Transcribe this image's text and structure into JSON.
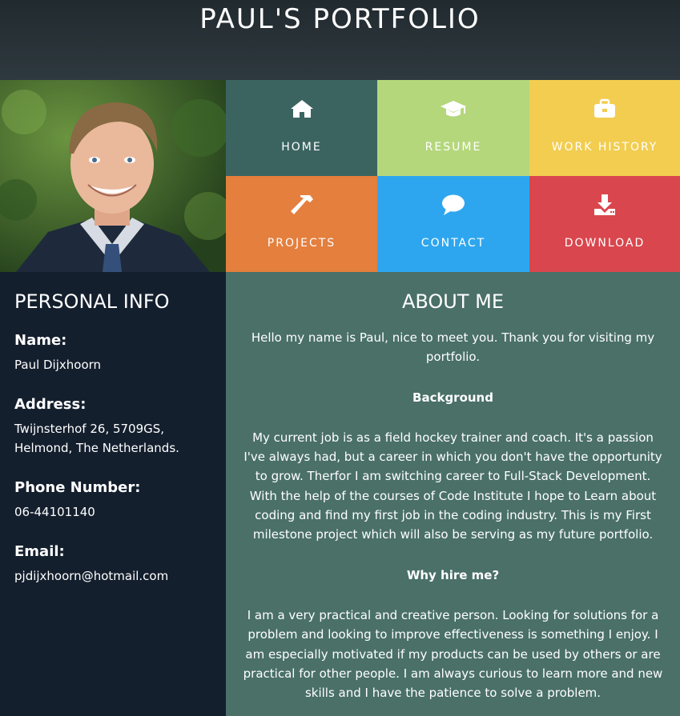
{
  "header": {
    "title": "PAUL'S PORTFOLIO"
  },
  "colors": {
    "home": "#3b6461",
    "resume": "#b5d77c",
    "work": "#f2cd50",
    "projects": "#e47f3e",
    "contact": "#2da6ef",
    "download": "#d9464d",
    "sidebar": "#141f2e",
    "main": "#4a7068"
  },
  "nav": {
    "home": {
      "label": "HOME",
      "icon": "home-icon"
    },
    "resume": {
      "label": "RESUME",
      "icon": "graduation-cap-icon"
    },
    "work": {
      "label": "WORK HISTORY",
      "icon": "briefcase-icon"
    },
    "projects": {
      "label": "PROJECTS",
      "icon": "hammer-icon"
    },
    "contact": {
      "label": "CONTACT",
      "icon": "chat-bubble-icon"
    },
    "download": {
      "label": "DOWNLOAD",
      "icon": "download-icon"
    }
  },
  "personal": {
    "title": "PERSONAL INFO",
    "name_label": "Name:",
    "name": "Paul Dijxhoorn",
    "address_label": "Address:",
    "address_line1": "Twijnsterhof 26, 5709GS,",
    "address_line2": "Helmond, The Netherlands.",
    "phone_label": "Phone Number:",
    "phone": "06-44101140",
    "email_label": "Email:",
    "email": "pjdijxhoorn@hotmail.com"
  },
  "about": {
    "title": "ABOUT ME",
    "intro": "Hello my name is Paul, nice to meet you. Thank you for visiting my portfolio.",
    "background_heading": "Background",
    "background_text": "My current job is as a field hockey trainer and coach. It's a passion I've always had, but a career in which you don't have the opportunity to grow. Therfor I am switching career to Full-Stack Development. With the help of the courses of Code Institute I hope to Learn about coding and find my first job in the coding industry. This is my First milestone project which will also be serving as my future portfolio.",
    "why_heading": "Why hire me?",
    "why_text": "I am a very practical and creative person. Looking for solutions for a problem and looking to improve effectiveness is something I enjoy. I am especially motivated if my products can be used by others or are practical for other people. I am always curious to learn more and new skills and I have the patience to solve a problem."
  }
}
